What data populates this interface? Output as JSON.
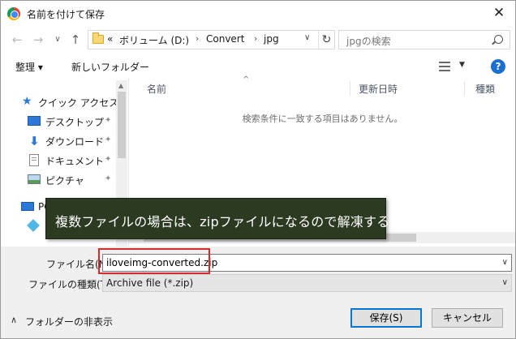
{
  "window": {
    "title": "名前を付けて保存",
    "close": "✕"
  },
  "nav": {
    "back": "←",
    "forward": "→",
    "recent": "∨",
    "up": "↑",
    "breadcrumb": {
      "overflow": "«",
      "parts": [
        "ボリューム (D:)",
        "Convert",
        "jpg"
      ],
      "sep": "›"
    },
    "dropdown": "∨",
    "refresh": "↻"
  },
  "search": {
    "placeholder": "jpgの検索"
  },
  "toolbar": {
    "organize": "整理 ▾",
    "new_folder": "新しいフォルダー",
    "help": "?"
  },
  "sidebar": {
    "quick_access": "クイック アクセス",
    "items": [
      {
        "label": "デスクトップ",
        "pin": "📌"
      },
      {
        "label": "ダウンロード",
        "pin": "📌"
      },
      {
        "label": "ドキュメント",
        "pin": "📌"
      },
      {
        "label": "ピクチャ",
        "pin": "📌"
      }
    ],
    "pc": "PC"
  },
  "filelist": {
    "columns": [
      "名前",
      "更新日時",
      "種類"
    ],
    "empty_message": "検索条件に一致する項目はありません。"
  },
  "tooltip": {
    "text": "複数ファイルの場合は、zipファイルになるので解凍する"
  },
  "form": {
    "filename_label": "ファイル名(N):",
    "filename_value": "iloveimg-converted.zip",
    "filetype_label": "ファイルの種類(T):",
    "filetype_value": "Archive file (*.zip)"
  },
  "footer": {
    "hide_folders": "フォルダーの非表示",
    "save": "保存(S)",
    "cancel": "キャンセル"
  },
  "colors": {
    "accent": "#0078d7",
    "highlight": "#d92a2a",
    "tooltip_bg": "#2d3a22"
  }
}
